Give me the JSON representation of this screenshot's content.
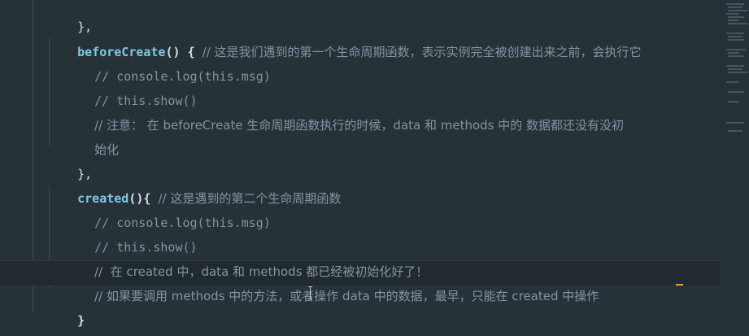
{
  "editor": {
    "lines": [
      {
        "indent": "",
        "code": "},"
      },
      {
        "fn": "beforeCreate",
        "after_fn": "() { ",
        "comment": "// 这是我们遇到的第一个生命周期函数，表示实例完全被创建出来之前，会执行它"
      },
      {
        "comment": "// console.log(this.msg)"
      },
      {
        "comment": "// this.show()"
      },
      {
        "comment": "// 注意： 在 beforeCreate 生命周期函数执行的时候，data 和 methods 中的 数据都还没有没初"
      },
      {
        "comment": "始化"
      },
      {
        "code": "},"
      },
      {
        "fn": "created",
        "after_fn": "(){ ",
        "comment": "// 这是遇到的第二个生命周期函数"
      },
      {
        "comment": "// console.log(this.msg)"
      },
      {
        "comment": "// this.show()"
      },
      {
        "comment": "//  在 created 中，data 和 methods 都已经被初始化好了！"
      },
      {
        "comment": "// 如果要调用 methods 中的方法，或者操作 data 中的数据，最早，只能在 created 中操作"
      },
      {
        "code": "}"
      },
      {
        "code": "});"
      }
    ]
  }
}
